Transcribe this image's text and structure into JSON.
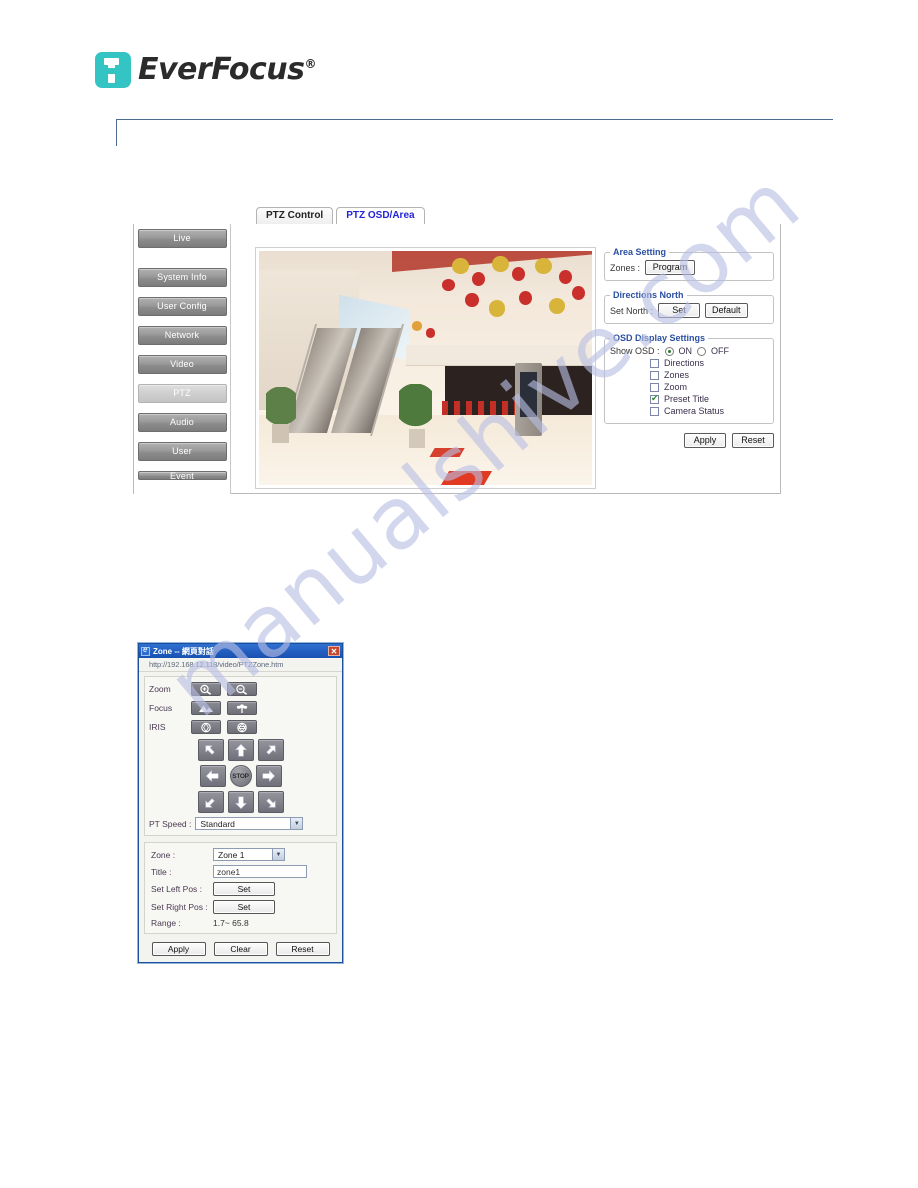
{
  "brand": {
    "name": "EverFocus",
    "registered": "®"
  },
  "watermark": {
    "text": "manualshive.com"
  },
  "webui": {
    "tabs": [
      {
        "label": "PTZ Control",
        "active": false
      },
      {
        "label": "PTZ OSD/Area",
        "active": true
      }
    ],
    "sidebar": {
      "items": [
        {
          "label": "Live",
          "active": false
        },
        {
          "label": "System Info",
          "active": false
        },
        {
          "label": "User Config",
          "active": false
        },
        {
          "label": "Network",
          "active": false
        },
        {
          "label": "Video",
          "active": false
        },
        {
          "label": "PTZ",
          "active": true
        },
        {
          "label": "Audio",
          "active": false
        },
        {
          "label": "User",
          "active": false
        },
        {
          "label": "Event",
          "active": false
        }
      ]
    },
    "area_setting": {
      "legend": "Area Setting",
      "zones_label": "Zones :",
      "program_button": "Program"
    },
    "directions_north": {
      "legend": "Directions North",
      "set_north_label": "Set North :",
      "set_button": "Set",
      "default_button": "Default"
    },
    "osd_display": {
      "legend": "OSD Display Settings",
      "show_osd_label": "Show OSD :",
      "on_label": "ON",
      "off_label": "OFF",
      "show_osd_value": "ON",
      "checkboxes": [
        {
          "label": "Directions",
          "checked": false
        },
        {
          "label": "Zones",
          "checked": false
        },
        {
          "label": "Zoom",
          "checked": false
        },
        {
          "label": "Preset Title",
          "checked": true
        },
        {
          "label": "Camera Status",
          "checked": false
        }
      ],
      "apply_button": "Apply",
      "reset_button": "Reset"
    }
  },
  "dialog": {
    "title": "Zone -- 網頁對話",
    "url": "http://192.168.12.118/video/PTZZone.htm",
    "close_label": "✕",
    "controls": {
      "zoom_label": "Zoom",
      "focus_label": "Focus",
      "iris_label": "IRIS",
      "stop_label": "STOP",
      "pt_speed_label": "PT Speed :",
      "pt_speed_value": "Standard"
    },
    "zone_form": {
      "zone_label": "Zone :",
      "zone_value": "Zone 1",
      "title_label": "Title :",
      "title_value": "zone1",
      "set_left_label": "Set Left Pos :",
      "set_left_button": "Set",
      "set_right_label": "Set Right Pos :",
      "set_right_button": "Set",
      "range_label": "Range :",
      "range_value": "1.7~ 65.8"
    },
    "actions": {
      "apply": "Apply",
      "clear": "Clear",
      "reset": "Reset"
    }
  }
}
